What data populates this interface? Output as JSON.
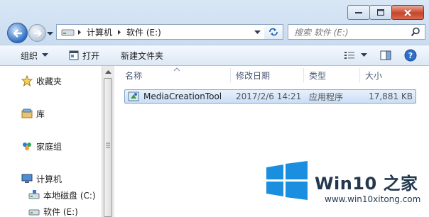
{
  "address": {
    "path": [
      "计算机",
      "软件 (E:)"
    ]
  },
  "search": {
    "placeholder": "搜索 软件 (E:)"
  },
  "toolbar": {
    "organize": "组织",
    "open": "打开",
    "new_folder": "新建文件夹"
  },
  "nav": {
    "items": [
      {
        "label": "收藏夹",
        "icon": "star-icon"
      },
      {
        "label": "库",
        "icon": "library-icon"
      },
      {
        "label": "家庭组",
        "icon": "homegroup-icon"
      },
      {
        "label": "计算机",
        "icon": "computer-icon"
      },
      {
        "label": "本地磁盘 (C:)",
        "icon": "drive-icon"
      },
      {
        "label": "软件 (E:)",
        "icon": "drive-icon"
      }
    ]
  },
  "columns": {
    "name": "名称",
    "date": "修改日期",
    "type": "类型",
    "size": "大小"
  },
  "files": [
    {
      "name": "MediaCreationTool",
      "date": "2017/2/6 14:21",
      "type": "应用程序",
      "size": "17,881 KB",
      "icon": "app-icon"
    }
  ],
  "watermark": {
    "title": "Win10 之家",
    "url": "www.win10xitong.com"
  },
  "colors": {
    "selection": "#c9dff7",
    "accent": "#2c6dc4",
    "win_logo": "#1a8fe0"
  }
}
